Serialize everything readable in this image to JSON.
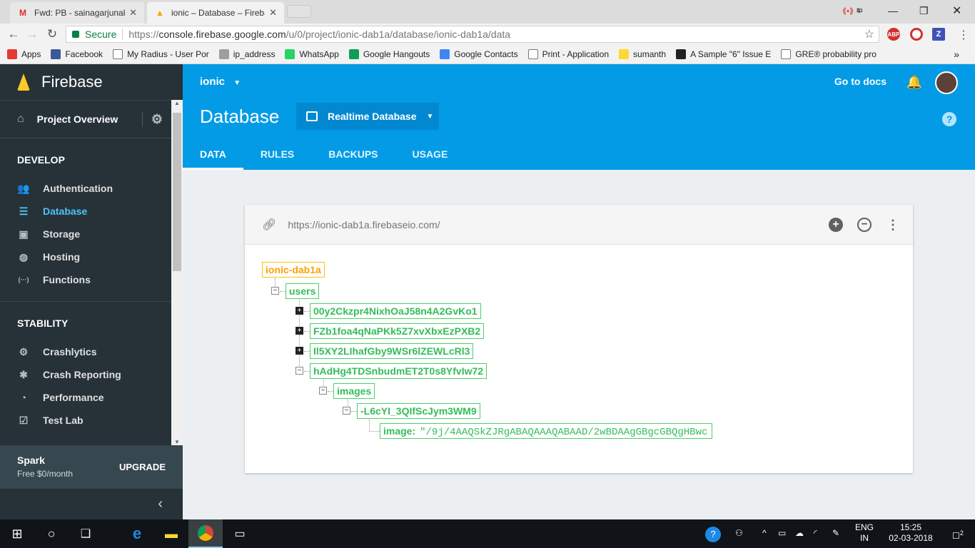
{
  "browser": {
    "tabs": [
      {
        "title": "Fwd: PB - sainagarjunakc",
        "favicon": "gmail-icon",
        "active": false
      },
      {
        "title": "ionic – Database – Fireba",
        "favicon": "firebase-icon",
        "active": true
      }
    ],
    "user_label": "ఖ",
    "secure_label": "Secure",
    "url_prefix": "https://",
    "url_host": "console.firebase.google.com",
    "url_path": "/u/0/project/ionic-dab1a/database/ionic-dab1a/data",
    "extensions": [
      "ABP",
      "O",
      "Z"
    ],
    "bookmarks": [
      {
        "label": "Apps",
        "icon": "apps-grid-icon",
        "color": "#e53935"
      },
      {
        "label": "Facebook",
        "icon": "facebook-icon",
        "color": "#3b5998"
      },
      {
        "label": "My Radius - User Por",
        "icon": "page-icon",
        "color": "#ffffff"
      },
      {
        "label": "ip_address",
        "icon": "fiber-icon",
        "color": "#9e9e9e"
      },
      {
        "label": "WhatsApp",
        "icon": "whatsapp-icon",
        "color": "#25d366"
      },
      {
        "label": "Google Hangouts",
        "icon": "hangouts-icon",
        "color": "#0f9d58"
      },
      {
        "label": "Google Contacts",
        "icon": "contacts-icon",
        "color": "#4285f4"
      },
      {
        "label": "Print - Application",
        "icon": "page-icon",
        "color": "#ffffff"
      },
      {
        "label": "sumanth",
        "icon": "folder-icon",
        "color": "#fdd835"
      },
      {
        "label": "A Sample \"6\" Issue E",
        "icon": "star-icon",
        "color": "#212121"
      },
      {
        "label": "GRE® probability pro",
        "icon": "page-icon",
        "color": "#ffffff"
      }
    ]
  },
  "sidebar": {
    "brand": "Firebase",
    "overview": "Project Overview",
    "develop_title": "DEVELOP",
    "develop_items": [
      {
        "label": "Authentication",
        "icon": "people-icon",
        "glyph": "👥"
      },
      {
        "label": "Database",
        "icon": "database-icon",
        "glyph": "☰"
      },
      {
        "label": "Storage",
        "icon": "storage-icon",
        "glyph": "▣"
      },
      {
        "label": "Hosting",
        "icon": "globe-icon",
        "glyph": "◍"
      },
      {
        "label": "Functions",
        "icon": "functions-icon",
        "glyph": "(···)"
      }
    ],
    "stability_title": "STABILITY",
    "stability_items": [
      {
        "label": "Crashlytics",
        "icon": "crashlytics-icon",
        "glyph": "⚙"
      },
      {
        "label": "Crash Reporting",
        "icon": "bug-icon",
        "glyph": "✱"
      },
      {
        "label": "Performance",
        "icon": "gauge-icon",
        "glyph": "◔"
      },
      {
        "label": "Test Lab",
        "icon": "checklist-icon",
        "glyph": "☑"
      }
    ],
    "plan_name": "Spark",
    "plan_price": "Free $0/month",
    "upgrade": "UPGRADE",
    "collapse_glyph": "‹"
  },
  "header": {
    "project": "ionic",
    "go_to_docs": "Go to docs",
    "title": "Database",
    "db_selector": "Realtime Database",
    "tabs": [
      "DATA",
      "RULES",
      "BACKUPS",
      "USAGE"
    ],
    "active_tab": "DATA"
  },
  "database": {
    "url": "https://ionic-dab1a.firebaseio.com/",
    "root": "ionic-dab1a",
    "users": "users",
    "user_keys": [
      "00y2Ckzpr4NixhOaJ58n4A2GvKo1",
      "FZb1foa4qNaPKk5Z7xvXbxEzPXB2",
      "Il5XY2LIhafGby9WSr6lZEWLcRl3",
      "hAdHg4TDSnbudmET2T0s8YfvIw72"
    ],
    "images": "images",
    "image_key": "-L6cYI_3QIfScJym3WM9",
    "image_label": "image:",
    "image_value": "\"/9j/4AAQSkZJRgABAQAAAQABAAD/2wBDAAgGBgcGBQgHBwc"
  },
  "taskbar": {
    "lang_top": "ENG",
    "lang_bottom": "IN",
    "time": "15:25",
    "date": "02-03-2018",
    "notifications": "2"
  }
}
